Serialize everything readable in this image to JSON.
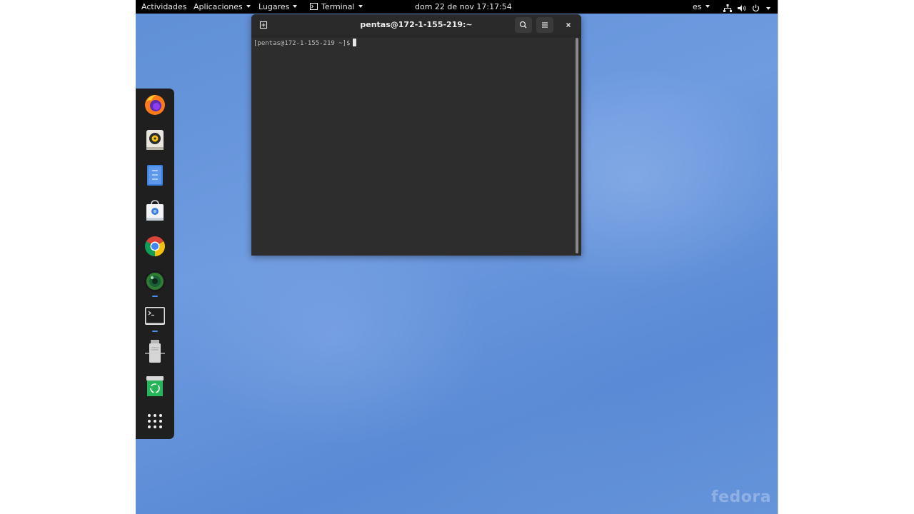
{
  "topbar": {
    "activities": "Actividades",
    "applications": "Aplicaciones",
    "places": "Lugares",
    "app_menu": "Terminal",
    "clock": "dom 22 de nov  17:17:54",
    "keyboard_layout": "es"
  },
  "terminal": {
    "title": "pentas@172-1-155-219:~",
    "prompt": "[pentas@172-1-155-219 ~]$"
  },
  "dash": {
    "items": [
      {
        "name": "firefox-icon",
        "running": false
      },
      {
        "name": "rhythmbox-icon",
        "running": false
      },
      {
        "name": "files-document-icon",
        "running": false
      },
      {
        "name": "software-store-icon",
        "running": false
      },
      {
        "name": "chrome-icon",
        "running": false
      },
      {
        "name": "camera-lens-icon",
        "running": true
      },
      {
        "name": "terminal-icon",
        "running": true
      },
      {
        "name": "usb-drive-icon",
        "running": false
      },
      {
        "name": "trash-recycle-icon",
        "running": false
      },
      {
        "name": "show-applications-grid-icon",
        "running": false
      }
    ]
  },
  "watermark": "fedora",
  "colors": {
    "topbar": "#000000",
    "desktop_blue": "#6a98dd",
    "terminal_bg": "#2d2d2d",
    "accent": "#4a90ea"
  }
}
